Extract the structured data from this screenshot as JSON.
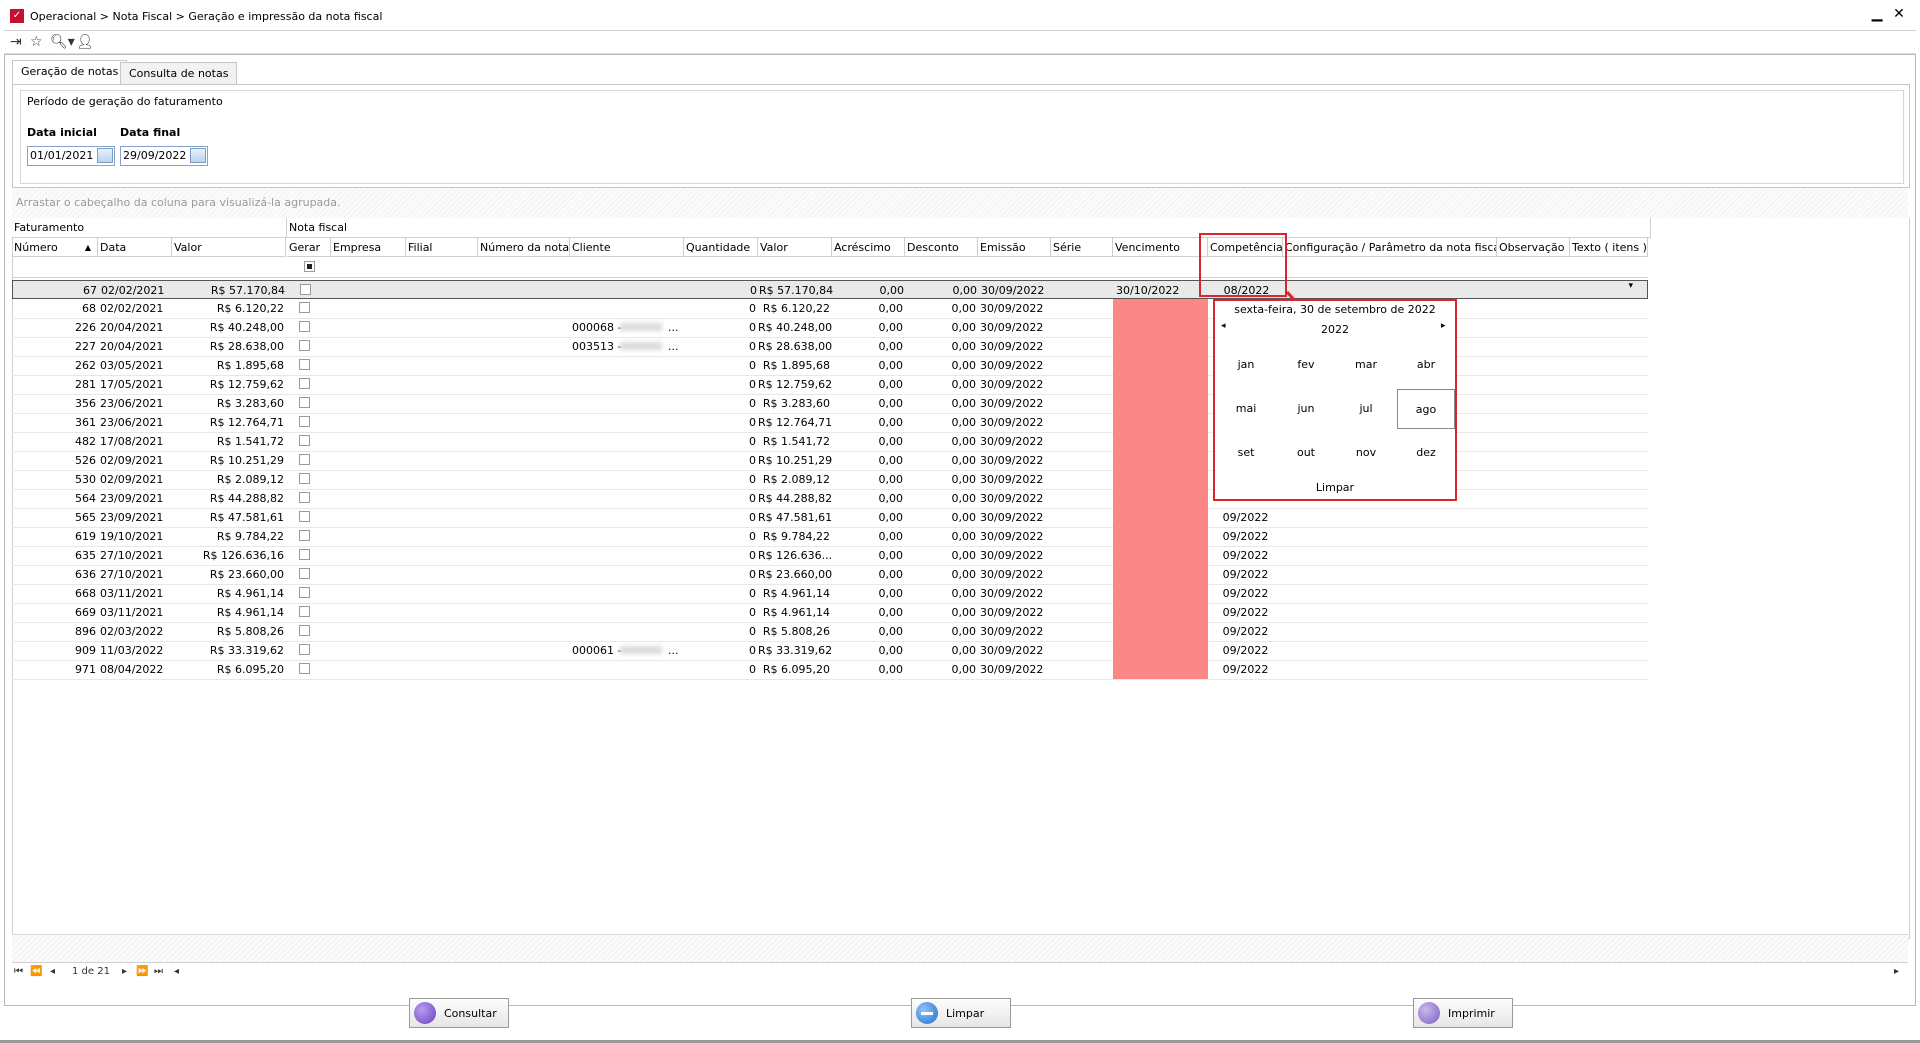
{
  "window": {
    "breadcrumb": "Operacional > Nota Fiscal > Geração e impressão da nota fiscal",
    "minimize_label": "▬",
    "close_label": "✕"
  },
  "tabs": [
    {
      "label": "Geração de notas",
      "active": true
    },
    {
      "label": "Consulta de notas",
      "active": false
    }
  ],
  "period": {
    "title": "Período de geração do faturamento",
    "start_label": "Data inicial",
    "start_value": "01/01/2021",
    "end_label": "Data final",
    "end_value": "29/09/2022"
  },
  "grid": {
    "group_hint": "Arrastar o cabeçalho da coluna para visualizá-la agrupada.",
    "bands": [
      "Faturamento",
      "Nota fiscal"
    ],
    "columns": [
      "Número",
      "Data",
      "Valor",
      "Gerar",
      "Empresa",
      "Filial",
      "Número da nota",
      "Cliente",
      "Quantidade",
      "Valor",
      "Acréscimo",
      "Desconto",
      "Emissão",
      "Série",
      "Vencimento",
      "Competência",
      "Configuração / Parâmetro da nota fiscal",
      "Observação",
      "Texto ( itens )"
    ],
    "rows": [
      {
        "numero": "67",
        "data": "02/02/2021",
        "valor": "R$ 57.170,84",
        "cliente": "",
        "qtd": "0",
        "nf_valor": "R$ 57.170,84",
        "acrescimo": "0,00",
        "desconto": "0,00",
        "emissao": "30/09/2022",
        "vencimento": "30/10/2022",
        "competencia": "08/2022"
      },
      {
        "numero": "68",
        "data": "02/02/2021",
        "valor": "R$ 6.120,22",
        "cliente": "",
        "qtd": "0",
        "nf_valor": "R$ 6.120,22",
        "acrescimo": "0,00",
        "desconto": "0,00",
        "emissao": "30/09/2022",
        "vencimento": "",
        "competencia": ""
      },
      {
        "numero": "226",
        "data": "20/04/2021",
        "valor": "R$ 40.248,00",
        "cliente": "000068 - ",
        "qtd": "0",
        "nf_valor": "R$ 40.248,00",
        "acrescimo": "0,00",
        "desconto": "0,00",
        "emissao": "30/09/2022",
        "vencimento": "",
        "competencia": ""
      },
      {
        "numero": "227",
        "data": "20/04/2021",
        "valor": "R$ 28.638,00",
        "cliente": "003513 - ",
        "qtd": "0",
        "nf_valor": "R$ 28.638,00",
        "acrescimo": "0,00",
        "desconto": "0,00",
        "emissao": "30/09/2022",
        "vencimento": "",
        "competencia": ""
      },
      {
        "numero": "262",
        "data": "03/05/2021",
        "valor": "R$ 1.895,68",
        "cliente": "",
        "qtd": "0",
        "nf_valor": "R$ 1.895,68",
        "acrescimo": "0,00",
        "desconto": "0,00",
        "emissao": "30/09/2022",
        "vencimento": "",
        "competencia": ""
      },
      {
        "numero": "281",
        "data": "17/05/2021",
        "valor": "R$ 12.759,62",
        "cliente": "",
        "qtd": "0",
        "nf_valor": "R$ 12.759,62",
        "acrescimo": "0,00",
        "desconto": "0,00",
        "emissao": "30/09/2022",
        "vencimento": "",
        "competencia": ""
      },
      {
        "numero": "356",
        "data": "23/06/2021",
        "valor": "R$ 3.283,60",
        "cliente": "",
        "qtd": "0",
        "nf_valor": "R$ 3.283,60",
        "acrescimo": "0,00",
        "desconto": "0,00",
        "emissao": "30/09/2022",
        "vencimento": "",
        "competencia": ""
      },
      {
        "numero": "361",
        "data": "23/06/2021",
        "valor": "R$ 12.764,71",
        "cliente": "",
        "qtd": "0",
        "nf_valor": "R$ 12.764,71",
        "acrescimo": "0,00",
        "desconto": "0,00",
        "emissao": "30/09/2022",
        "vencimento": "",
        "competencia": ""
      },
      {
        "numero": "482",
        "data": "17/08/2021",
        "valor": "R$ 1.541,72",
        "cliente": "",
        "qtd": "0",
        "nf_valor": "R$ 1.541,72",
        "acrescimo": "0,00",
        "desconto": "0,00",
        "emissao": "30/09/2022",
        "vencimento": "",
        "competencia": ""
      },
      {
        "numero": "526",
        "data": "02/09/2021",
        "valor": "R$ 10.251,29",
        "cliente": "",
        "qtd": "0",
        "nf_valor": "R$ 10.251,29",
        "acrescimo": "0,00",
        "desconto": "0,00",
        "emissao": "30/09/2022",
        "vencimento": "",
        "competencia": ""
      },
      {
        "numero": "530",
        "data": "02/09/2021",
        "valor": "R$ 2.089,12",
        "cliente": "",
        "qtd": "0",
        "nf_valor": "R$ 2.089,12",
        "acrescimo": "0,00",
        "desconto": "0,00",
        "emissao": "30/09/2022",
        "vencimento": "",
        "competencia": ""
      },
      {
        "numero": "564",
        "data": "23/09/2021",
        "valor": "R$ 44.288,82",
        "cliente": "",
        "qtd": "0",
        "nf_valor": "R$ 44.288,82",
        "acrescimo": "0,00",
        "desconto": "0,00",
        "emissao": "30/09/2022",
        "vencimento": "",
        "competencia": ""
      },
      {
        "numero": "565",
        "data": "23/09/2021",
        "valor": "R$ 47.581,61",
        "cliente": "",
        "qtd": "0",
        "nf_valor": "R$ 47.581,61",
        "acrescimo": "0,00",
        "desconto": "0,00",
        "emissao": "30/09/2022",
        "vencimento": "",
        "competencia": "09/2022"
      },
      {
        "numero": "619",
        "data": "19/10/2021",
        "valor": "R$ 9.784,22",
        "cliente": "",
        "qtd": "0",
        "nf_valor": "R$ 9.784,22",
        "acrescimo": "0,00",
        "desconto": "0,00",
        "emissao": "30/09/2022",
        "vencimento": "",
        "competencia": "09/2022"
      },
      {
        "numero": "635",
        "data": "27/10/2021",
        "valor": "R$ 126.636,16",
        "cliente": "",
        "qtd": "0",
        "nf_valor": "R$ 126.636...",
        "acrescimo": "0,00",
        "desconto": "0,00",
        "emissao": "30/09/2022",
        "vencimento": "",
        "competencia": "09/2022"
      },
      {
        "numero": "636",
        "data": "27/10/2021",
        "valor": "R$ 23.660,00",
        "cliente": "",
        "qtd": "0",
        "nf_valor": "R$ 23.660,00",
        "acrescimo": "0,00",
        "desconto": "0,00",
        "emissao": "30/09/2022",
        "vencimento": "",
        "competencia": "09/2022"
      },
      {
        "numero": "668",
        "data": "03/11/2021",
        "valor": "R$ 4.961,14",
        "cliente": "",
        "qtd": "0",
        "nf_valor": "R$ 4.961,14",
        "acrescimo": "0,00",
        "desconto": "0,00",
        "emissao": "30/09/2022",
        "vencimento": "",
        "competencia": "09/2022"
      },
      {
        "numero": "669",
        "data": "03/11/2021",
        "valor": "R$ 4.961,14",
        "cliente": "",
        "qtd": "0",
        "nf_valor": "R$ 4.961,14",
        "acrescimo": "0,00",
        "desconto": "0,00",
        "emissao": "30/09/2022",
        "vencimento": "",
        "competencia": "09/2022"
      },
      {
        "numero": "896",
        "data": "02/03/2022",
        "valor": "R$ 5.808,26",
        "cliente": "",
        "qtd": "0",
        "nf_valor": "R$ 5.808,26",
        "acrescimo": "0,00",
        "desconto": "0,00",
        "emissao": "30/09/2022",
        "vencimento": "",
        "competencia": "09/2022"
      },
      {
        "numero": "909",
        "data": "11/03/2022",
        "valor": "R$ 33.319,62",
        "cliente": "000061 - ",
        "qtd": "0",
        "nf_valor": "R$ 33.319,62",
        "acrescimo": "0,00",
        "desconto": "0,00",
        "emissao": "30/09/2022",
        "vencimento": "",
        "competencia": "09/2022"
      },
      {
        "numero": "971",
        "data": "08/04/2022",
        "valor": "R$ 6.095,20",
        "cliente": "",
        "qtd": "0",
        "nf_valor": "R$ 6.095,20",
        "acrescimo": "0,00",
        "desconto": "0,00",
        "emissao": "30/09/2022",
        "vencimento": "",
        "competencia": "09/2022"
      }
    ]
  },
  "calendar": {
    "header": "sexta-feira, 30 de setembro de 2022",
    "year": "2022",
    "months": [
      "jan",
      "fev",
      "mar",
      "abr",
      "mai",
      "jun",
      "jul",
      "ago",
      "set",
      "out",
      "nov",
      "dez"
    ],
    "selected_month": "ago",
    "clear_label": "Limpar"
  },
  "pager": {
    "page_text": "1 de 21"
  },
  "buttons": {
    "consultar": "Consultar",
    "limpar": "Limpar",
    "imprimir": "Imprimir"
  },
  "colors": {
    "highlight_red": "#d9262e",
    "vencimento_pink": "#fb8787",
    "consultar_icon": "#7b4fc9",
    "limpar_icon": "#2f7fd6",
    "imprimir_icon": "#8a6fc6"
  },
  "icons": [
    "exit-icon",
    "favorite-star-icon",
    "search-icon",
    "user-icon",
    "calendar-icon",
    "sort-asc-icon",
    "dropdown-arrow-icon",
    "prev-year-icon",
    "next-year-icon",
    "first-page-icon",
    "prev-page-icon",
    "next-page-icon",
    "last-page-icon"
  ]
}
